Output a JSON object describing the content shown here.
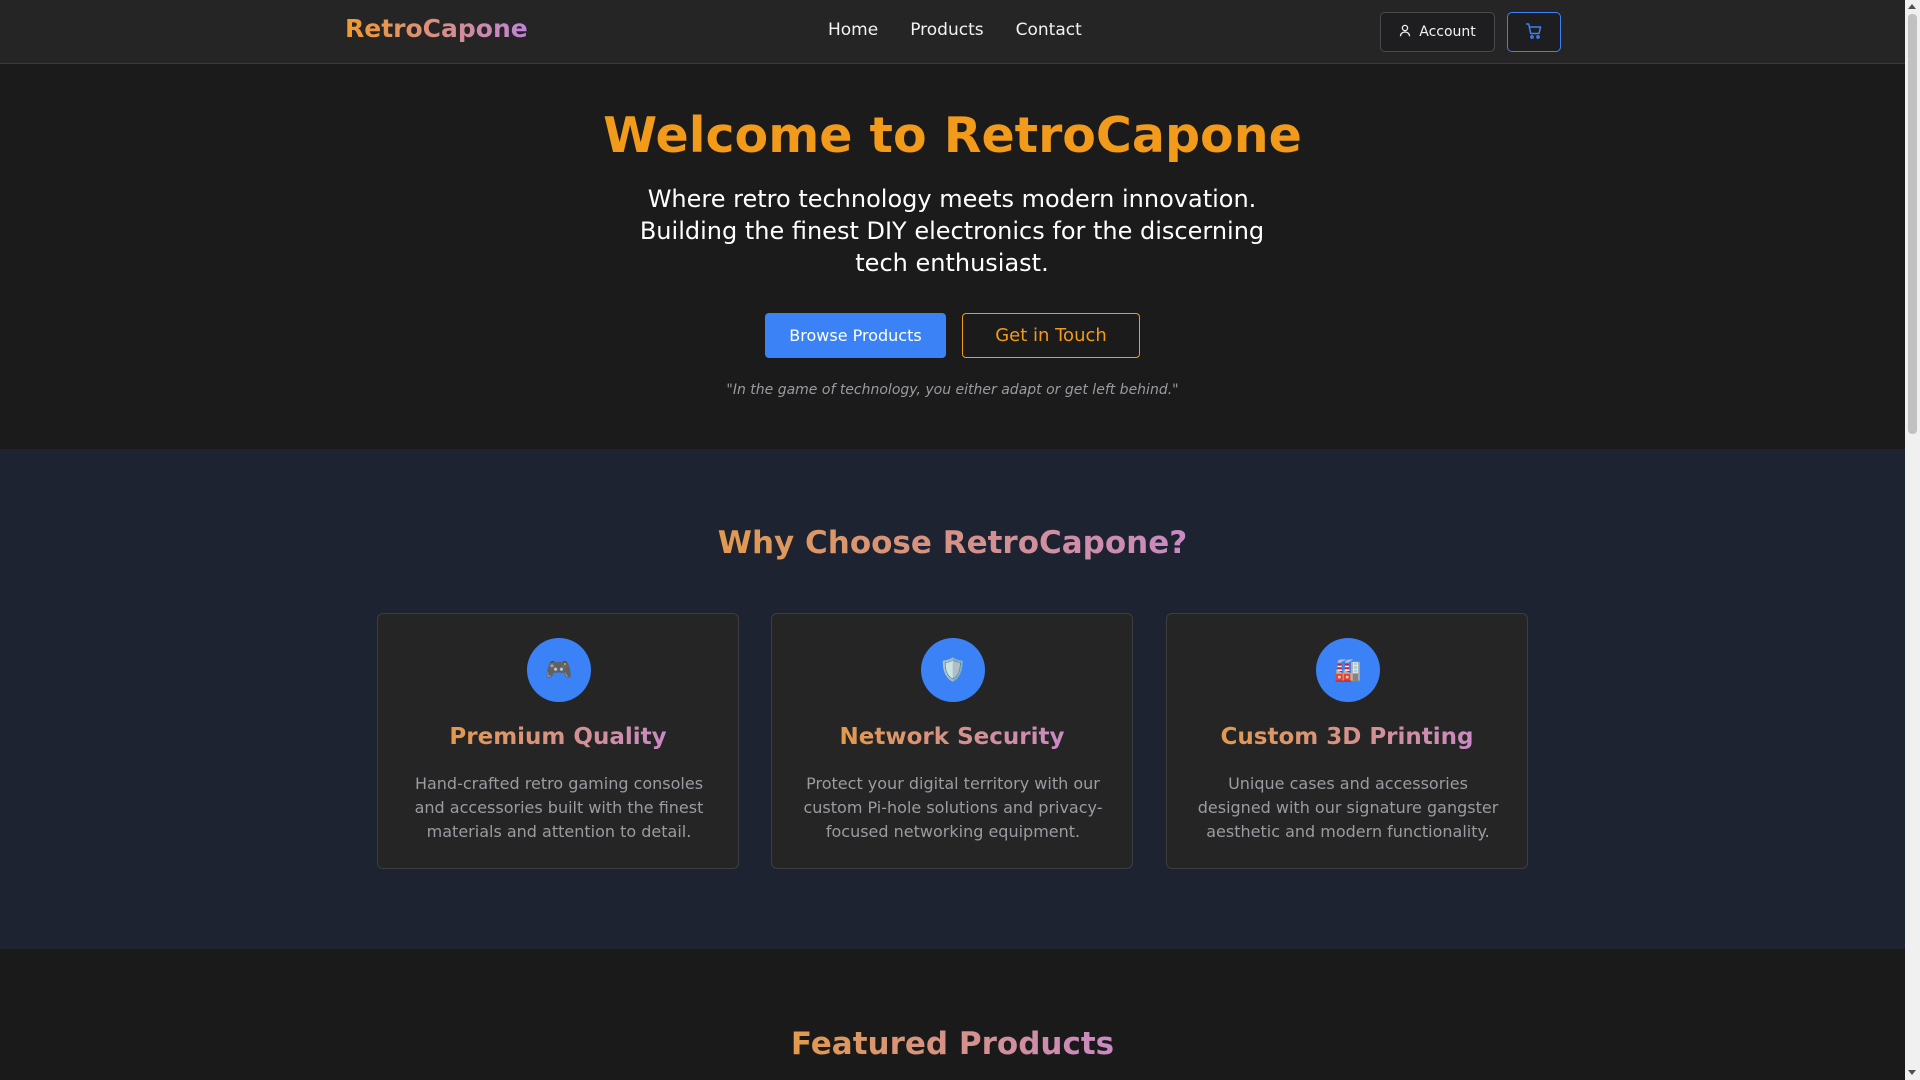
{
  "header": {
    "brand": "RetroCapone",
    "nav": [
      "Home",
      "Products",
      "Contact"
    ],
    "account_label": "Account",
    "cart_icon": "cart-icon",
    "user_icon": "user-icon"
  },
  "hero": {
    "title": "Welcome to RetroCapone",
    "subtitle": "Where retro technology meets modern innovation. Building the finest DIY electronics for the discerning tech enthusiast.",
    "primary_button": "Browse Products",
    "secondary_button": "Get in Touch",
    "quote": "\"In the game of technology, you either adapt or get left behind.\""
  },
  "why": {
    "title": "Why Choose RetroCapone?",
    "cards": [
      {
        "icon": "🎮",
        "icon_name": "gamepad-icon",
        "title": "Premium Quality",
        "description": "Hand-crafted retro gaming consoles and accessories built with the finest materials and attention to detail."
      },
      {
        "icon": "🛡️",
        "icon_name": "shield-icon",
        "title": "Network Security",
        "description": "Protect your digital territory with our custom Pi-hole solutions and privacy-focused networking equipment."
      },
      {
        "icon": "🏭",
        "icon_name": "factory-icon",
        "title": "Custom 3D Printing",
        "description": "Unique cases and accessories designed with our signature gangster aesthetic and modern functionality."
      }
    ]
  },
  "featured": {
    "title": "Featured Products"
  },
  "colors": {
    "accent_orange": "#f29a1a",
    "accent_blue": "#3b82f6",
    "gradient_purple": "#c084d8"
  }
}
